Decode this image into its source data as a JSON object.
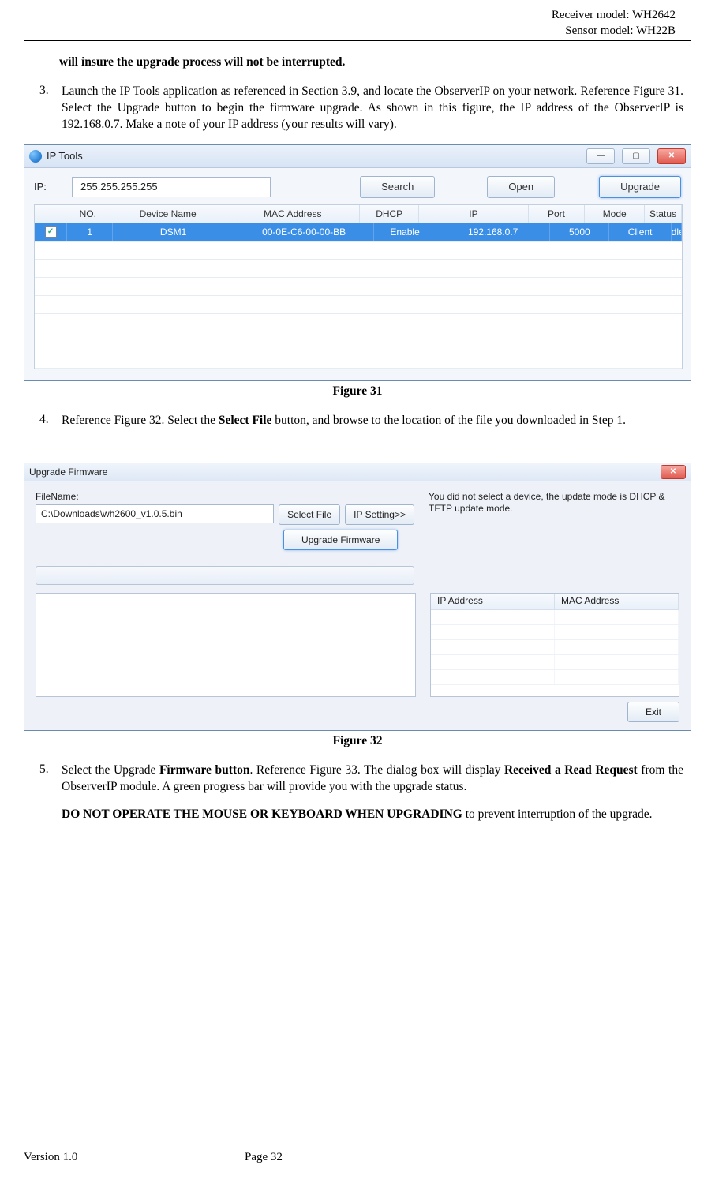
{
  "header": {
    "receiver": "Receiver model: WH2642",
    "sensor": "Sensor model: WH22B"
  },
  "para_bold_continued": "will insure the upgrade process will not be interrupted.",
  "step3": {
    "num": "3.",
    "text": "Launch the IP Tools application as referenced in Section 3.9, and locate the ObserverIP on your network. Reference Figure 31. Select the Upgrade button to begin the firmware upgrade. As shown in this figure, the IP address of the ObserverIP is 192.168.0.7. Make a note of your IP address (your results will vary)."
  },
  "iptools": {
    "title": "IP Tools",
    "ip_label": "IP:",
    "ip_value": "255.255.255.255",
    "btn_search": "Search",
    "btn_open": "Open",
    "btn_upgrade": "Upgrade",
    "cols": {
      "no": "NO.",
      "name": "Device Name",
      "mac": "MAC Address",
      "dhcp": "DHCP",
      "ip": "IP",
      "port": "Port",
      "mode": "Mode",
      "status": "Status"
    },
    "row": {
      "checked": "✓",
      "no": "1",
      "name": "DSM1",
      "mac": "00-0E-C6-00-00-BB",
      "dhcp": "Enable",
      "ip": "192.168.0.7",
      "port": "5000",
      "mode": "Client",
      "status": "Idle"
    }
  },
  "fig31": "Figure 31",
  "step4": {
    "num": "4.",
    "pre": "Reference Figure 32.    Select the ",
    "bold": "Select File",
    "post": " button, and browse to the location of the file you downloaded in Step 1."
  },
  "upgrade": {
    "title": "Upgrade Firmware",
    "filename_label": "FileName:",
    "filename_value": "C:\\Downloads\\wh2600_v1.0.5.bin",
    "btn_select": "Select File",
    "btn_ipset": "IP Setting>>",
    "btn_upgrade": "Upgrade Firmware",
    "status_msg": "You did not select a device, the update mode is DHCP & TFTP update mode.",
    "col_ip": "IP Address",
    "col_mac": "MAC Address",
    "btn_exit": "Exit"
  },
  "fig32": "Figure 32",
  "step5": {
    "num": "5.",
    "t1": "Select the Upgrade ",
    "b1": "Firmware button",
    "t2": ". Reference Figure 33.   The dialog box will display ",
    "b2": "Received a Read Request",
    "t3": " from the ObserverIP module. A green progress bar will provide you with the upgrade status."
  },
  "step5b": {
    "b1": "DO NOT OPERATE THE MOUSE OR KEYBOARD WHEN UPGRADING",
    "t1": " to prevent interruption of the upgrade."
  },
  "footer": {
    "version": "Version 1.0",
    "page": "Page 32"
  }
}
